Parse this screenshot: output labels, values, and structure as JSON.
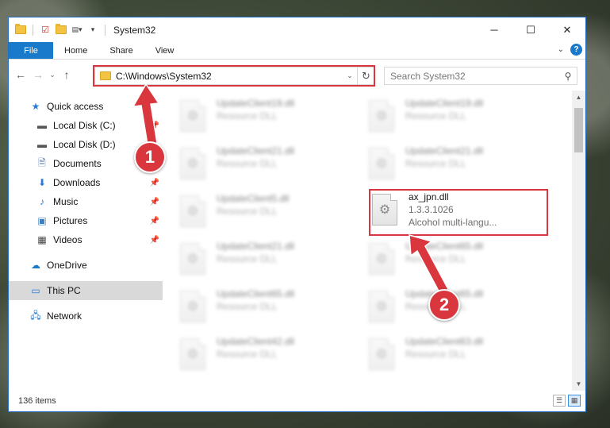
{
  "window": {
    "title": "System32",
    "controls": {
      "minimize": "─",
      "maximize": "☐",
      "close": "✕"
    }
  },
  "ribbon": {
    "tabs": [
      "File",
      "Home",
      "Share",
      "View"
    ],
    "help": "?"
  },
  "address": {
    "path": "C:\\Windows\\System32",
    "search_placeholder": "Search System32"
  },
  "sidebar": {
    "quick_access": "Quick access",
    "quick_items": [
      {
        "label": "Local Disk (C:)",
        "icon": "drive-icon",
        "pinned": true
      },
      {
        "label": "Local Disk (D:)",
        "icon": "drive-icon",
        "pinned": false
      },
      {
        "label": "Documents",
        "icon": "documents-icon",
        "pinned": true
      },
      {
        "label": "Downloads",
        "icon": "downloads-icon",
        "pinned": true
      },
      {
        "label": "Music",
        "icon": "music-icon",
        "pinned": true
      },
      {
        "label": "Pictures",
        "icon": "pictures-icon",
        "pinned": true
      },
      {
        "label": "Videos",
        "icon": "videos-icon",
        "pinned": true
      }
    ],
    "onedrive": "OneDrive",
    "thispc": "This PC",
    "network": "Network"
  },
  "files": [
    {
      "name": "UpdateClient19.dll",
      "sub": "Resource DLL",
      "blurred": true
    },
    {
      "name": "UpdateClient19.dll",
      "sub": "Resource DLL",
      "blurred": true
    },
    {
      "name": "UpdateClient21.dll",
      "sub": "Resource DLL",
      "blurred": true
    },
    {
      "name": "UpdateClient21.dll",
      "sub": "Resource DLL",
      "blurred": true
    },
    {
      "name": "UpdateClient5.dll",
      "sub": "Resource DLL",
      "blurred": true
    },
    {
      "name": "ax_jpn.dll",
      "sub": "1.3.3.1026",
      "sub2": "Alcohol multi-langu...",
      "blurred": false
    },
    {
      "name": "UpdateClient21.dll",
      "sub": "Resource DLL",
      "blurred": true
    },
    {
      "name": "UpdateClient65.dll",
      "sub": "Resource DLL",
      "blurred": true
    },
    {
      "name": "UpdateClient65.dll",
      "sub": "Resource DLL",
      "blurred": true
    },
    {
      "name": "UpdateClient65.dll",
      "sub": "Resource DLL",
      "blurred": true
    },
    {
      "name": "UpdateClient42.dll",
      "sub": "Resource DLL",
      "blurred": true
    },
    {
      "name": "UpdateClient63.dll",
      "sub": "Resource DLL",
      "blurred": true
    }
  ],
  "status": {
    "item_count": "136 items"
  },
  "annotations": {
    "step1": "1",
    "step2": "2",
    "color": "#d9363e"
  }
}
